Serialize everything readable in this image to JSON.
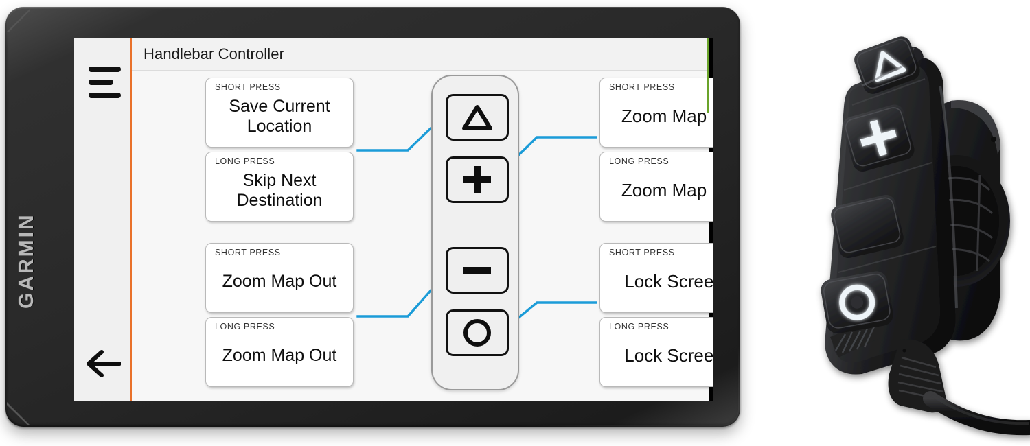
{
  "device": {
    "brand": "GARMIN",
    "sidebar": {
      "menu_icon": "hamburger-menu-icon",
      "back_icon": "back-arrow-icon"
    },
    "screen": {
      "title": "Handlebar Controller",
      "accent_color": "#e9712a",
      "green_accent_color": "#6aa32a",
      "background_color": "#f7f7f7"
    }
  },
  "controller": {
    "buttons": [
      {
        "id": "triangle",
        "icon": "triangle-icon",
        "glyph": "triangle"
      },
      {
        "id": "plus",
        "icon": "plus-icon",
        "glyph": "plus"
      },
      {
        "id": "minus",
        "icon": "minus-icon",
        "glyph": "minus"
      },
      {
        "id": "circle",
        "icon": "circle-icon",
        "glyph": "circle"
      }
    ],
    "leader_color": "#1b9cd8"
  },
  "cards": {
    "left": [
      {
        "press": "SHORT PRESS",
        "action": "Save Current Location",
        "button": "triangle"
      },
      {
        "press": "LONG PRESS",
        "action": "Skip Next Destination",
        "button": "triangle"
      },
      {
        "press": "SHORT PRESS",
        "action": "Zoom Map Out",
        "button": "minus"
      },
      {
        "press": "LONG PRESS",
        "action": "Zoom Map Out",
        "button": "minus"
      }
    ],
    "right": [
      {
        "press": "SHORT PRESS",
        "action": "Zoom Map In",
        "button": "plus"
      },
      {
        "press": "LONG PRESS",
        "action": "Zoom Map In",
        "button": "plus"
      },
      {
        "press": "SHORT PRESS",
        "action": "Lock Screen",
        "button": "circle"
      },
      {
        "press": "LONG PRESS",
        "action": "Lock Screen",
        "button": "circle"
      }
    ]
  },
  "remote": {
    "name": "handlebar-remote-device",
    "buttons": [
      {
        "id": "triangle",
        "icon": "triangle-icon"
      },
      {
        "id": "plus",
        "icon": "plus-icon"
      },
      {
        "id": "minus",
        "icon": "minus-icon"
      },
      {
        "id": "circle",
        "icon": "circle-icon"
      }
    ],
    "body_color": "#1a1a1a",
    "glyph_color": "#eef4f8"
  }
}
